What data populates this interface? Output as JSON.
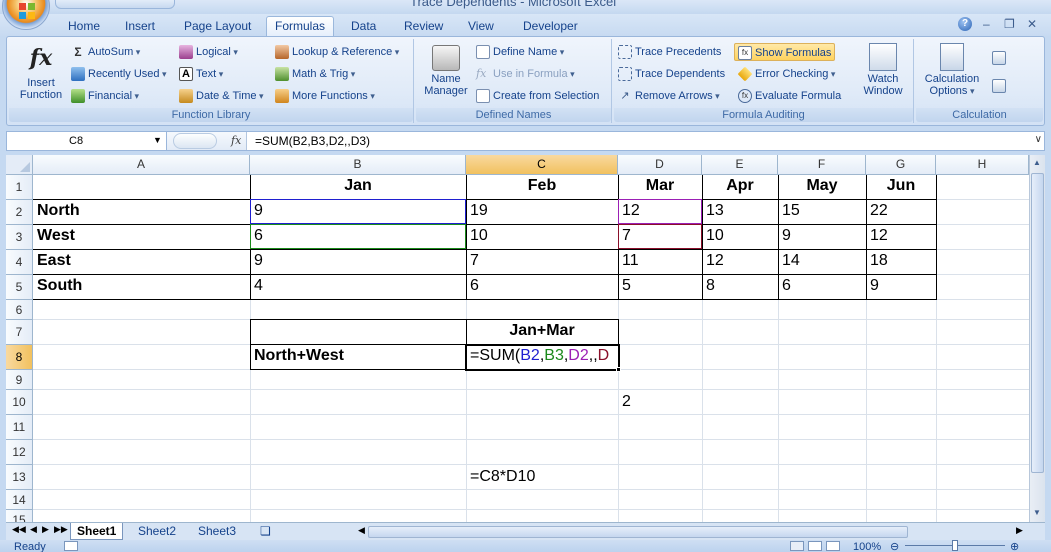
{
  "window": {
    "title": "Trace Dependents - Microsoft Excel"
  },
  "tabs": [
    "Home",
    "Insert",
    "Page Layout",
    "Formulas",
    "Data",
    "Review",
    "View",
    "Developer"
  ],
  "active_tab": "Formulas",
  "ribbon": {
    "function_library": {
      "label": "Function Library",
      "insert_function": "Insert\nFunction",
      "insert_function_l1": "Insert",
      "insert_function_l2": "Function",
      "autosum": "AutoSum",
      "recently_used": "Recently Used",
      "financial": "Financial",
      "logical": "Logical",
      "text": "Text",
      "date_time": "Date & Time",
      "lookup_reference": "Lookup & Reference",
      "math_trig": "Math & Trig",
      "more_functions": "More Functions"
    },
    "defined_names": {
      "label": "Defined Names",
      "name_manager_l1": "Name",
      "name_manager_l2": "Manager",
      "define_name": "Define Name",
      "use_in_formula": "Use in Formula",
      "create_from_selection": "Create from Selection"
    },
    "formula_auditing": {
      "label": "Formula Auditing",
      "trace_precedents": "Trace Precedents",
      "trace_dependents": "Trace Dependents",
      "remove_arrows": "Remove Arrows",
      "show_formulas": "Show Formulas",
      "error_checking": "Error Checking",
      "evaluate_formula": "Evaluate Formula",
      "watch_window_l1": "Watch",
      "watch_window_l2": "Window"
    },
    "calculation": {
      "label": "Calculation",
      "options_l1": "Calculation",
      "options_l2": "Options"
    }
  },
  "formula_bar": {
    "name_box": "C8",
    "fx": "fx",
    "formula": "=SUM(B2,B3,D2,,D3)"
  },
  "columns": [
    "A",
    "B",
    "C",
    "D",
    "E",
    "F",
    "G",
    "H"
  ],
  "rows": [
    "1",
    "2",
    "3",
    "4",
    "5",
    "6",
    "7",
    "8",
    "9",
    "10",
    "11",
    "12",
    "13",
    "14",
    "15"
  ],
  "selected_cell": {
    "col": "C",
    "row": "8"
  },
  "sheet": {
    "header": [
      "",
      "Jan",
      "Feb",
      "Mar",
      "Apr",
      "May",
      "Jun"
    ],
    "data": [
      [
        "North",
        "9",
        "19",
        "12",
        "13",
        "15",
        "22"
      ],
      [
        "West",
        "6",
        "10",
        "7",
        "10",
        "9",
        "12"
      ],
      [
        "East",
        "9",
        "7",
        "11",
        "12",
        "14",
        "18"
      ],
      [
        "South",
        "4",
        "6",
        "5",
        "8",
        "6",
        "9"
      ]
    ],
    "c7": "Jan+Mar",
    "b8": "North+West",
    "c8_parts": [
      "=SUM(",
      "B2",
      ",",
      "B3",
      ",",
      "D2",
      ",,",
      "D"
    ],
    "d10": "2",
    "c13": "=C8*D10"
  },
  "ref_colors": {
    "B2": "#1f1fd0",
    "B3": "#1b8a1b",
    "D2": "#9b1fb5",
    "D3": "#8a0f2a"
  },
  "sheet_tabs": [
    "Sheet1",
    "Sheet2",
    "Sheet3"
  ],
  "active_sheet": "Sheet1",
  "status": {
    "ready": "Ready",
    "zoom": "100%"
  }
}
